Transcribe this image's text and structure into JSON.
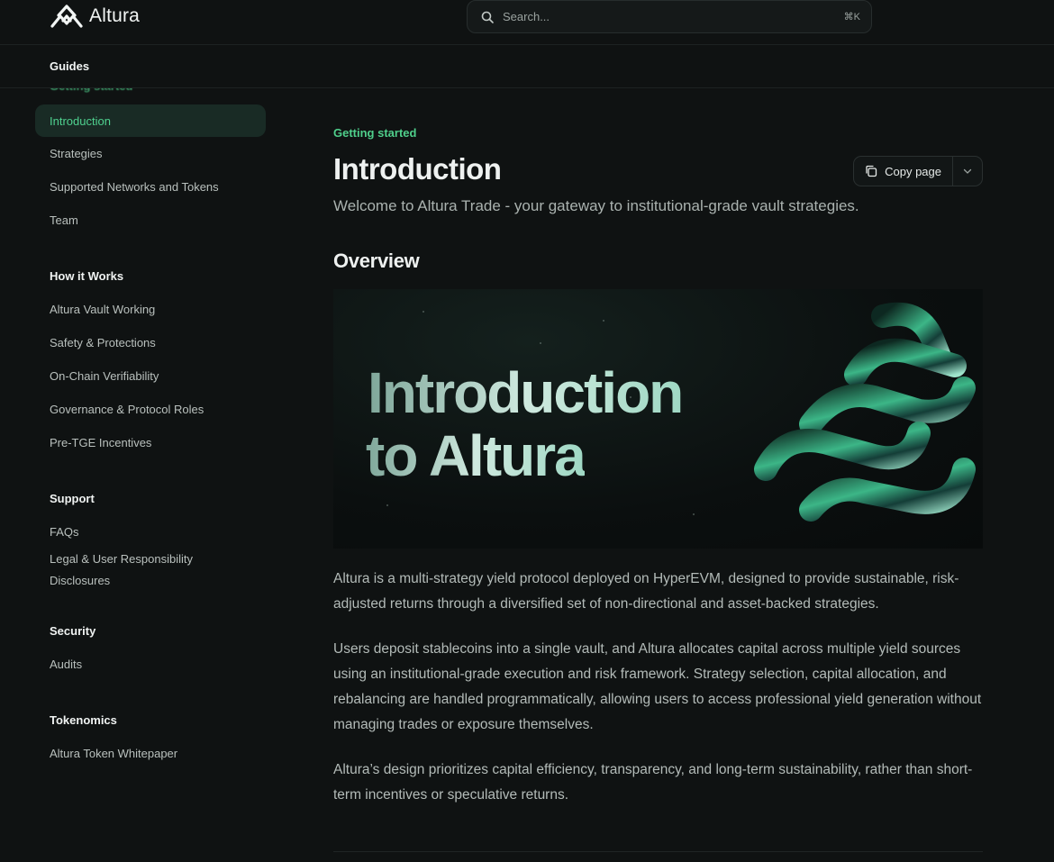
{
  "brand": {
    "name": "Altura"
  },
  "search": {
    "placeholder": "Search...",
    "shortcut": "⌘K"
  },
  "subbar": {
    "tab": "Guides",
    "ghost": "Getting started"
  },
  "sidebar": {
    "items": [
      {
        "label": "Introduction",
        "active": true
      },
      {
        "label": "Strategies"
      },
      {
        "label": "Supported Networks and Tokens"
      },
      {
        "label": "Team"
      }
    ],
    "sections": [
      {
        "title": "How it Works",
        "items": [
          "Altura Vault Working",
          "Safety & Protections",
          "On-Chain Verifiability",
          "Governance & Protocol Roles",
          "Pre-TGE Incentives"
        ]
      },
      {
        "title": "Support",
        "items": [
          "FAQs",
          "Legal & User Responsibility Disclosures"
        ]
      },
      {
        "title": "Security",
        "items": [
          "Audits"
        ]
      },
      {
        "title": "Tokenomics",
        "items": [
          "Altura Token Whitepaper"
        ]
      }
    ]
  },
  "main": {
    "eyebrow": "Getting started",
    "title": "Introduction",
    "copy_label": "Copy page",
    "subtitle": "Welcome to Altura Trade - your gateway to institutional-grade vault strategies.",
    "overview": "Overview",
    "banner": {
      "line1": "Introduction",
      "line2": "to Altura"
    },
    "paragraphs": [
      "Altura is a multi-strategy yield protocol deployed on HyperEVM, designed to provide sustainable, risk-adjusted returns through a diversified set of non-directional and asset-backed strategies.",
      "Users deposit stablecoins into a single vault, and Altura allocates capital across multiple yield sources using an institutional-grade execution and risk framework. Strategy selection, capital allocation, and rebalancing are handled programmatically, allowing users to access professional yield generation without managing trades or exposure themselves.",
      "Altura’s design prioritizes capital efficiency, transparency, and long-term sustainability, rather than short-term incentives or speculative returns."
    ]
  },
  "colors": {
    "accent": "#4fcf8b",
    "background": "#0f1212",
    "active_bg": "#192b25"
  }
}
